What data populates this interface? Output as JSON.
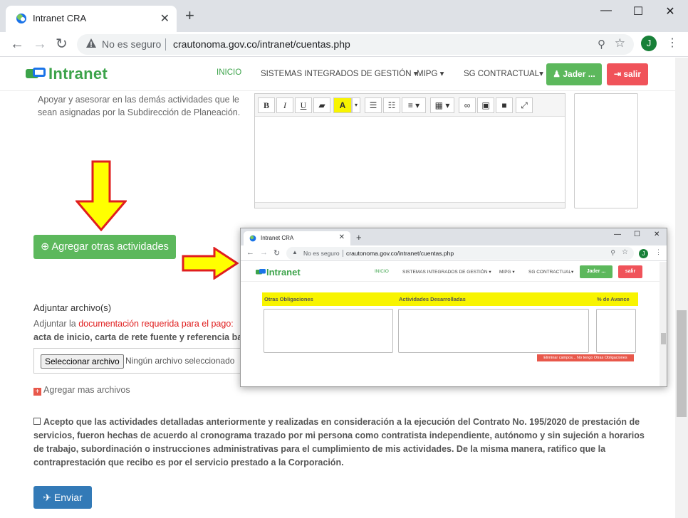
{
  "browser": {
    "tab_title": "Intranet CRA",
    "security_label": "No es seguro",
    "url": "crautonoma.gov.co/intranet/cuentas.php",
    "profile_initial": "J",
    "new_tab": "+",
    "close_tab": "✕",
    "minimize": "—",
    "maximize": "☐",
    "close_window": "✕"
  },
  "site": {
    "logo_text": "Intranet",
    "nav": {
      "inicio": "INICIO",
      "sistemas": "SISTEMAS INTEGRADOS DE GESTIÓN",
      "mipg": "MIPG",
      "sg_contractual": "SG CONTRACTUAL",
      "user_button": "Jader ...",
      "exit_button": "salir"
    },
    "colors": {
      "brand_green": "#3ca34a",
      "success": "#5cb85c",
      "danger": "#f0535a",
      "primary": "#337ab7",
      "highlight": "#f8f400"
    }
  },
  "form": {
    "activity_description": "Apoyar y asesorar en las demás actividades que le sean asignadas por la Subdirección de Planeación.",
    "editor_toolbar": [
      "B",
      "I",
      "U",
      "eraser",
      "A",
      "ul",
      "ol",
      "align",
      "table",
      "link",
      "image",
      "video",
      "fullscreen"
    ],
    "add_activities_button": "Agregar otras actividades",
    "attach_title": "Adjuntar archivo(s)",
    "attach_text_prefix": "Adjuntar la ",
    "attach_text_link": "documentación requerida para el pago:",
    "attach_text_line2": "acta de inicio, carta de rete fuente y referencia banc",
    "file_button": "Seleccionar archivo",
    "file_none": "Ningún archivo seleccionado",
    "more_files": "Agregar mas archivos",
    "acceptance": "Acepto que las actividades detalladas anteriormente y realizadas en consideración a la ejecución del Contrato No. 195/2020 de prestación de servicios, fueron hechas de acuerdo al cronograma trazado por mi persona como contratista independiente, autónomo y sin sujeción a horarios de trabajo, subordinación o instrucciones administrativas para el cumplimiento de mis actividades. De la misma manera, ratifico que la contraprestación que recibo es por el servicio prestado a la Corporación.",
    "send_button": "Enviar"
  },
  "inset": {
    "tab_title": "Intranet CRA",
    "security_label": "No es seguro",
    "url": "crautonoma.gov.co/intranet/cuentas.php",
    "logo_text": "Intranet",
    "nav_inicio": "INICIO",
    "nav_sistemas": "SISTEMAS INTEGRADOS DE GESTIÓN ▾",
    "nav_mipg": "MIPG ▾",
    "nav_sg": "SG CONTRACTUAL▾",
    "user_button": "Jader ...",
    "exit_button": "salir",
    "col_otras": "Otras Obligaciones",
    "col_actividades": "Actividades Desarrolladas",
    "col_avance": "% de Avance",
    "eliminar": "Eliminar campos... No tengo Otras Obligaciones",
    "profile_initial": "J"
  }
}
